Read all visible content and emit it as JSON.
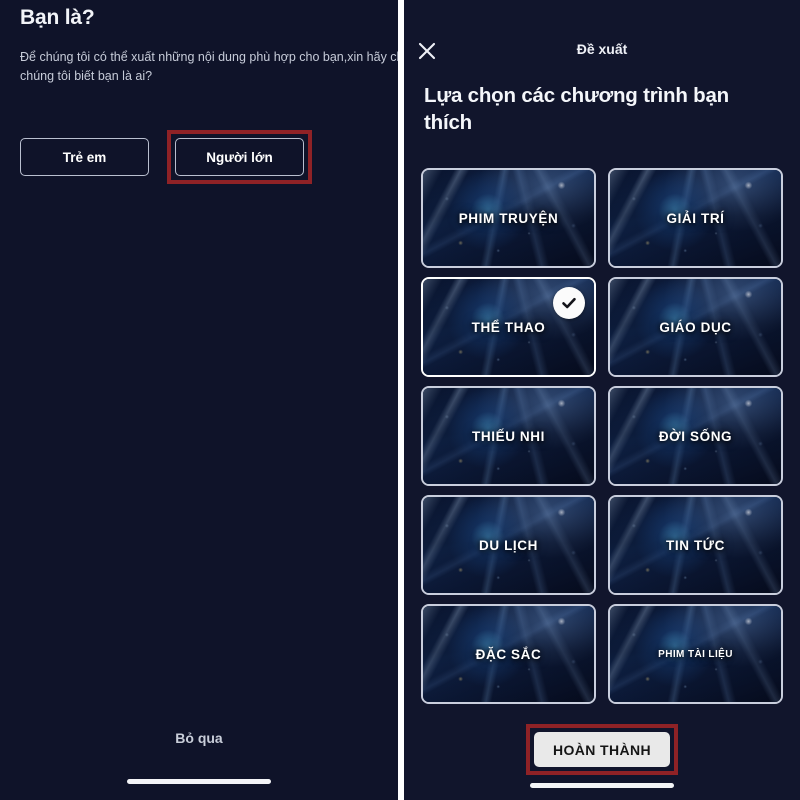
{
  "colors": {
    "background": "#0f1329",
    "panel_right_background": "#11152c",
    "highlight_red": "#8f2226",
    "button_light": "#e9e9e9",
    "text_primary": "#f4f6fa",
    "text_secondary": "#c6cbd8"
  },
  "left_screen": {
    "title": "Bạn là?",
    "subtitle": "Để chúng tôi có thể xuất những nội dung phù hợp cho bạn,xin hãy cho chúng tôi biết bạn là ai?",
    "choices": [
      {
        "label": "Trẻ em",
        "highlighted": false
      },
      {
        "label": "Người lớn",
        "highlighted": true
      }
    ],
    "skip_label": "Bỏ qua"
  },
  "right_screen": {
    "topbar": {
      "close_icon": "close-icon",
      "title": "Đề xuất"
    },
    "heading": "Lựa chọn các chương trình bạn thích",
    "tiles": [
      {
        "label": "PHIM TRUYỆN",
        "selected": false,
        "small": false
      },
      {
        "label": "GIẢI TRÍ",
        "selected": false,
        "small": false
      },
      {
        "label": "THỂ THAO",
        "selected": true,
        "small": false
      },
      {
        "label": "GIÁO DỤC",
        "selected": false,
        "small": false
      },
      {
        "label": "THIẾU NHI",
        "selected": false,
        "small": false
      },
      {
        "label": "ĐỜI SỐNG",
        "selected": false,
        "small": false
      },
      {
        "label": "DU LỊCH",
        "selected": false,
        "small": false
      },
      {
        "label": "TIN TỨC",
        "selected": false,
        "small": false
      },
      {
        "label": "ĐẶC SẮC",
        "selected": false,
        "small": false
      },
      {
        "label": "PHIM TÀI LIỆU",
        "selected": false,
        "small": true
      }
    ],
    "done_button": {
      "label": "HOÀN THÀNH",
      "highlighted": true
    }
  }
}
